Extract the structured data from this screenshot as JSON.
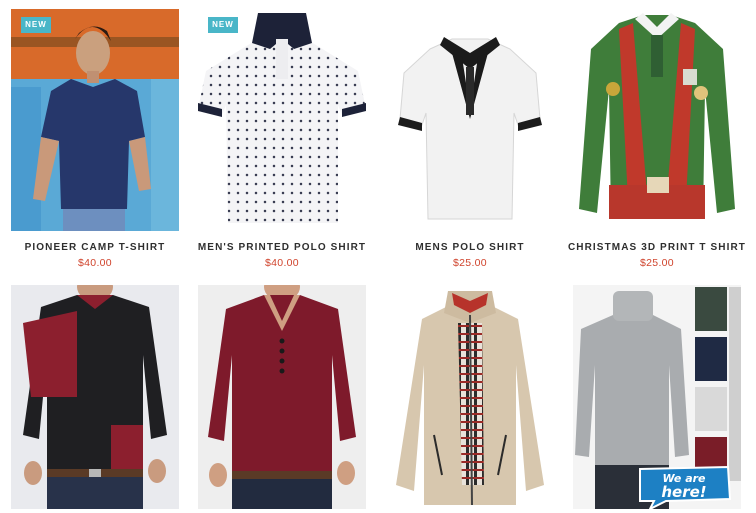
{
  "products": [
    {
      "name": "PIONEER CAMP T-SHIRT",
      "price": "$40.00",
      "badge": "NEW"
    },
    {
      "name": "MEN'S PRINTED POLO SHIRT",
      "price": "$40.00",
      "badge": "NEW"
    },
    {
      "name": "MENS POLO SHIRT",
      "price": "$25.00"
    },
    {
      "name": "CHRISTMAS 3D PRINT T SHIRT",
      "price": "$25.00"
    }
  ],
  "chat_widget": {
    "line1": "We are",
    "line2": "here!"
  },
  "colors": {
    "badge": "#49b6c8",
    "price": "#d0442d",
    "title": "#2f2f2f"
  }
}
